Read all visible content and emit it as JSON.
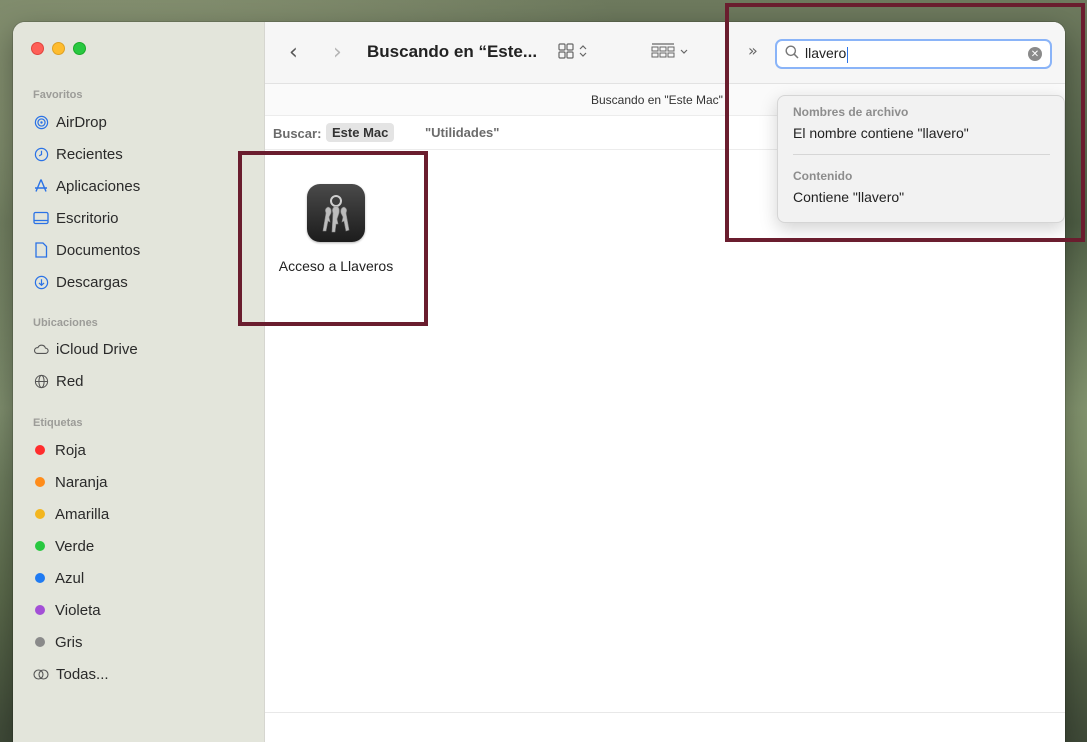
{
  "sidebar": {
    "favorites_title": "Favoritos",
    "favorites": [
      {
        "label": "AirDrop",
        "icon": "airdrop-icon"
      },
      {
        "label": "Recientes",
        "icon": "clock-icon"
      },
      {
        "label": "Aplicaciones",
        "icon": "applications-icon"
      },
      {
        "label": "Escritorio",
        "icon": "desktop-icon"
      },
      {
        "label": "Documentos",
        "icon": "document-icon"
      },
      {
        "label": "Descargas",
        "icon": "downloads-icon"
      }
    ],
    "locations_title": "Ubicaciones",
    "locations": [
      {
        "label": "iCloud Drive",
        "icon": "cloud-icon"
      },
      {
        "label": "Red",
        "icon": "network-icon"
      }
    ],
    "tags_title": "Etiquetas",
    "tags": [
      {
        "label": "Roja",
        "color": "#ff2d2d"
      },
      {
        "label": "Naranja",
        "color": "#ff8c1a"
      },
      {
        "label": "Amarilla",
        "color": "#f3b61f"
      },
      {
        "label": "Verde",
        "color": "#28c840"
      },
      {
        "label": "Azul",
        "color": "#1f7bf2"
      },
      {
        "label": "Violeta",
        "color": "#a34fd6"
      },
      {
        "label": "Gris",
        "color": "#8a8a8a"
      }
    ],
    "all_tags": "Todas..."
  },
  "toolbar": {
    "title": "Buscando en “Este...",
    "search_value": "llavero"
  },
  "path_bar": {
    "label": "Buscando en \"Este Mac\""
  },
  "scope_bar": {
    "label": "Buscar:",
    "active": "Este Mac",
    "alternate": "\"Utilidades\""
  },
  "results": [
    {
      "label": "Acceso a Llaveros"
    }
  ],
  "suggestions": {
    "filenames_header": "Nombres de archivo",
    "filenames_item": "El nombre contiene \"llavero\"",
    "content_header": "Contenido",
    "content_item": "Contiene \"llavero\""
  },
  "colors": {
    "accent": "#2a72e6",
    "highlight_box": "#6a1d2e"
  }
}
